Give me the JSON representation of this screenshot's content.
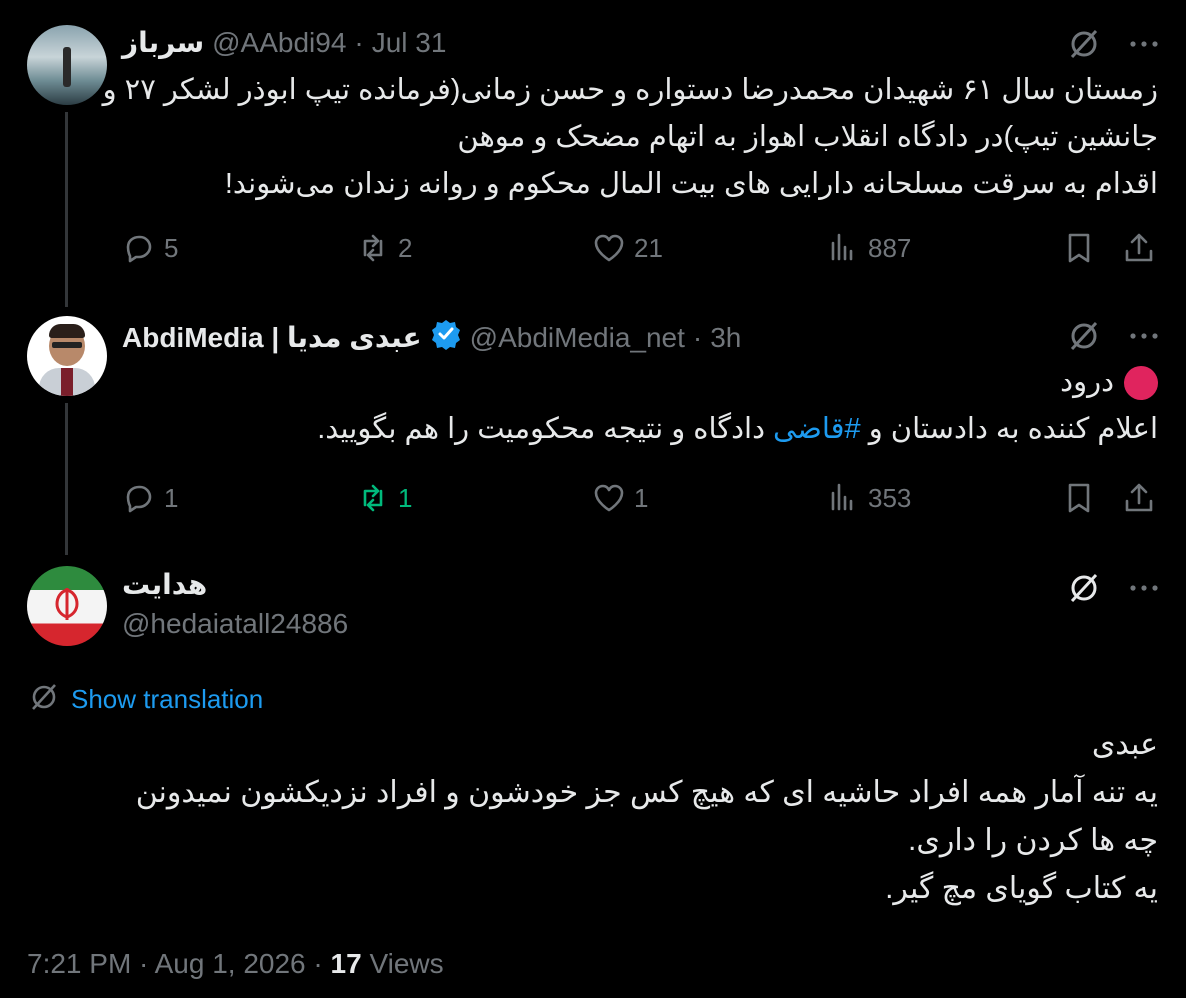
{
  "tweets": [
    {
      "name": "سرباز",
      "handle": "@AAbdi94",
      "sep": "·",
      "time": "Jul 31",
      "lines": [
        "زمستان سال ۶۱ شهیدان محمدرضا دستواره و حسن زمانی(فرمانده تیپ ابوذر لشکر ۲۷ و",
        "جانشین تیپ)در دادگاه انقلاب اهواز به اتهام مضحک و موهن",
        "اقدام به سرقت مسلحانه دارایی های بیت المال محکوم و روانه زندان می‌شوند!"
      ],
      "replies": "5",
      "retweets": "2",
      "likes": "21",
      "views": "887"
    },
    {
      "name": "AbdiMedia | عبدی مدیا",
      "handle": "@AbdiMedia_net",
      "sep": "·",
      "time": "3h",
      "greeting": "درود",
      "line_prefix": "اعلام کننده به دادستان و",
      "hashtag": "#قاضی",
      "line_suffix": "دادگاه و نتیجه محکومیت را هم بگویید.",
      "replies": "1",
      "retweets": "1",
      "likes": "1",
      "views": "353"
    }
  ],
  "main_tweet": {
    "name": "هدایت",
    "handle": "@hedaiatall24886",
    "translate_label": "Show translation",
    "lines": [
      "عبدی",
      "یه تنه آمار همه افراد حاشیه ای که هیچ کس جز خودشون و افراد نزدیکشون نمیدونن",
      "چه ها کردن را داری.",
      "یه کتاب گویای مچ گیر."
    ],
    "timestamp": "7:21 PM · Aug 1, 2026 ·",
    "views_count": "17",
    "views_label": "Views"
  },
  "colors": {
    "background": "#000000",
    "text": "#e7e9ea",
    "muted": "#71767b",
    "accent": "#1d9bf0",
    "retweet_active": "#00ba7c"
  }
}
